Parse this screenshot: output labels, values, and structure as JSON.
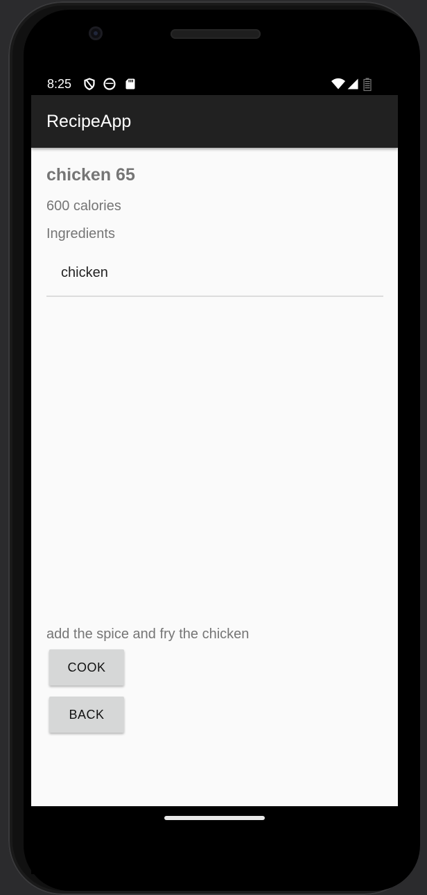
{
  "status_bar": {
    "time": "8:25",
    "left_icons": [
      "shield-icon",
      "face-icon",
      "sd-card-icon"
    ],
    "right_icons": [
      "wifi-icon",
      "signal-icon",
      "battery-icon"
    ]
  },
  "app_bar": {
    "title": "RecipeApp"
  },
  "recipe": {
    "name": "chicken 65",
    "calories": "600 calories",
    "ingredients_label": "Ingredients",
    "ingredients": [
      "chicken"
    ],
    "instructions": "add the spice and fry the chicken"
  },
  "buttons": {
    "cook": "COOK",
    "back": "BACK"
  },
  "colors": {
    "app_bar": "#212121",
    "screen_bg": "#fafafa",
    "secondary_text": "#757575",
    "button_bg": "#d6d7d7"
  }
}
